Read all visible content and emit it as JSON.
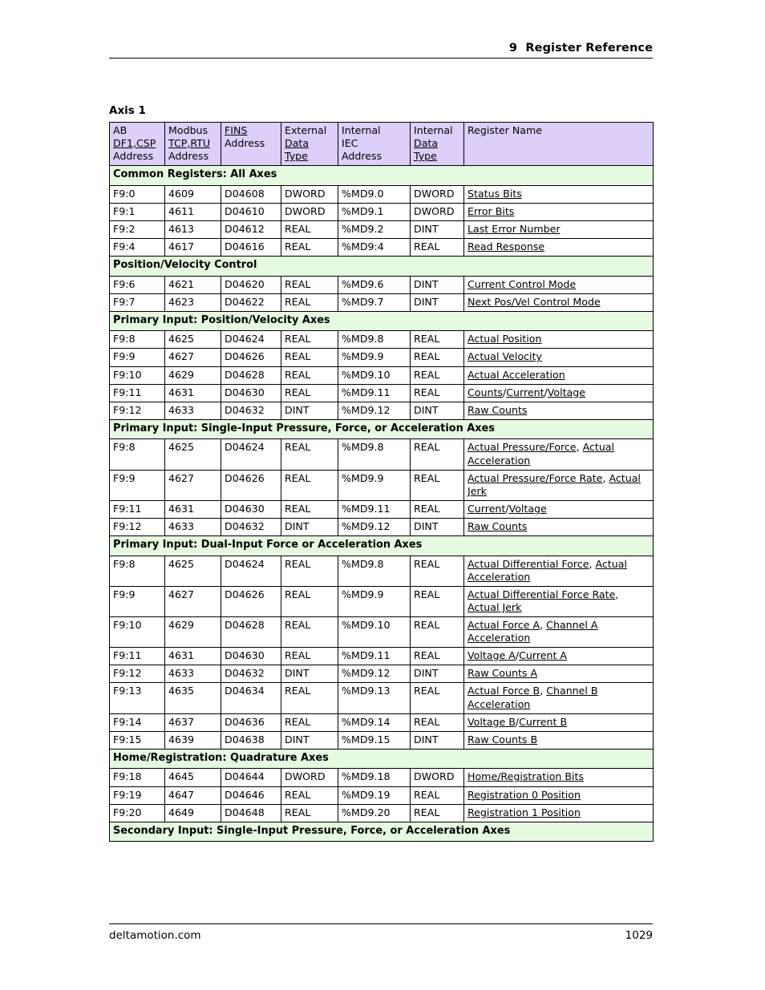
{
  "header": {
    "chapter_number": "9",
    "chapter_title": "Register Reference",
    "full_text": "9  Register Reference"
  },
  "footer": {
    "site": "deltamotion.com",
    "page_number": "1029"
  },
  "table": {
    "caption": "Axis 1",
    "columns": [
      {
        "key": "ab",
        "lines": [
          "AB",
          "DF1,CSP",
          "Address"
        ],
        "link_line_index": 1
      },
      {
        "key": "modbus",
        "lines": [
          "Modbus",
          "TCP,RTU",
          "Address"
        ],
        "link_line_index": 1
      },
      {
        "key": "fins",
        "lines": [
          "FINS",
          "Address"
        ],
        "link_line_index": 0
      },
      {
        "key": "extdtype",
        "lines": [
          "External",
          "Data",
          "Type"
        ],
        "link_line_index": 1,
        "link_line_index2": 2
      },
      {
        "key": "iecaddr",
        "lines": [
          "Internal",
          "IEC",
          "Address"
        ],
        "link_line_index": -1
      },
      {
        "key": "intdtype",
        "lines": [
          "Internal",
          "Data",
          "Type"
        ],
        "link_line_index": 1,
        "link_line_index2": 2
      },
      {
        "key": "regname",
        "lines": [
          "Register Name"
        ],
        "link_line_index": -1
      }
    ],
    "rows": [
      {
        "type": "section",
        "label": "Common Registers: All Axes"
      },
      {
        "type": "data",
        "ab": "F9:0",
        "modbus": "4609",
        "fins": "D04608",
        "ext": "DWORD",
        "iec": "%MD9.0",
        "int": "DWORD",
        "name": [
          {
            "t": "Status Bits",
            "link": true
          }
        ]
      },
      {
        "type": "data",
        "ab": "F9:1",
        "modbus": "4611",
        "fins": "D04610",
        "ext": "DWORD",
        "iec": "%MD9.1",
        "int": "DWORD",
        "name": [
          {
            "t": "Error Bits",
            "link": true
          }
        ]
      },
      {
        "type": "data",
        "ab": "F9:2",
        "modbus": "4613",
        "fins": "D04612",
        "ext": "REAL",
        "iec": "%MD9.2",
        "int": "DINT",
        "name": [
          {
            "t": "Last Error Number",
            "link": true
          }
        ]
      },
      {
        "type": "data",
        "ab": "F9:4",
        "modbus": "4617",
        "fins": "D04616",
        "ext": "REAL",
        "iec": "%MD9:4",
        "int": "REAL",
        "name": [
          {
            "t": "Read Response",
            "link": true
          }
        ]
      },
      {
        "type": "section",
        "label": "Position/Velocity Control"
      },
      {
        "type": "data",
        "ab": "F9:6",
        "modbus": "4621",
        "fins": "D04620",
        "ext": "REAL",
        "iec": "%MD9.6",
        "int": "DINT",
        "name": [
          {
            "t": "Current Control Mode",
            "link": true
          }
        ]
      },
      {
        "type": "data",
        "ab": "F9:7",
        "modbus": "4623",
        "fins": "D04622",
        "ext": "REAL",
        "iec": "%MD9.7",
        "int": "DINT",
        "name": [
          {
            "t": "Next Pos/Vel Control Mode",
            "link": true
          }
        ]
      },
      {
        "type": "section",
        "label": "Primary Input: Position/Velocity Axes"
      },
      {
        "type": "data",
        "ab": "F9:8",
        "modbus": "4625",
        "fins": "D04624",
        "ext": "REAL",
        "iec": "%MD9.8",
        "int": "REAL",
        "name": [
          {
            "t": "Actual Position",
            "link": true
          }
        ]
      },
      {
        "type": "data",
        "ab": "F9:9",
        "modbus": "4627",
        "fins": "D04626",
        "ext": "REAL",
        "iec": "%MD9.9",
        "int": "REAL",
        "name": [
          {
            "t": "Actual Velocity",
            "link": true
          }
        ]
      },
      {
        "type": "data",
        "ab": "F9:10",
        "modbus": "4629",
        "fins": "D04628",
        "ext": "REAL",
        "iec": "%MD9.10",
        "int": "REAL",
        "name": [
          {
            "t": "Actual Acceleration",
            "link": true
          }
        ]
      },
      {
        "type": "data",
        "ab": "F9:11",
        "modbus": "4631",
        "fins": "D04630",
        "ext": "REAL",
        "iec": "%MD9.11",
        "int": "REAL",
        "name": [
          {
            "t": "Counts",
            "link": true
          },
          {
            "t": "/",
            "link": false
          },
          {
            "t": "Current",
            "link": true
          },
          {
            "t": "/",
            "link": false
          },
          {
            "t": "Voltage",
            "link": true
          }
        ]
      },
      {
        "type": "data",
        "ab": "F9:12",
        "modbus": "4633",
        "fins": "D04632",
        "ext": "DINT",
        "iec": "%MD9.12",
        "int": "DINT",
        "name": [
          {
            "t": "Raw Counts",
            "link": true
          }
        ]
      },
      {
        "type": "section",
        "label": "Primary Input: Single-Input Pressure, Force, or Acceleration Axes"
      },
      {
        "type": "data",
        "ab": "F9:8",
        "modbus": "4625",
        "fins": "D04624",
        "ext": "REAL",
        "iec": "%MD9.8",
        "int": "REAL",
        "tall": true,
        "name": [
          {
            "t": "Actual Pressure/Force",
            "link": true
          },
          {
            "t": ", ",
            "link": false
          },
          {
            "t": "Actual Acceleration",
            "link": true
          }
        ]
      },
      {
        "type": "data",
        "ab": "F9:9",
        "modbus": "4627",
        "fins": "D04626",
        "ext": "REAL",
        "iec": "%MD9.9",
        "int": "REAL",
        "tall": true,
        "offset_first": true,
        "name": [
          {
            "t": "Actual Pressure/Force Rate",
            "link": true
          },
          {
            "t": ", ",
            "link": false
          },
          {
            "t": "Actual Jerk",
            "link": true
          }
        ]
      },
      {
        "type": "data",
        "ab": "F9:11",
        "modbus": "4631",
        "fins": "D04630",
        "ext": "REAL",
        "iec": "%MD9.11",
        "int": "REAL",
        "name": [
          {
            "t": "Current",
            "link": true
          },
          {
            "t": "/",
            "link": false
          },
          {
            "t": "Voltage",
            "link": true
          }
        ]
      },
      {
        "type": "data",
        "ab": "F9:12",
        "modbus": "4633",
        "fins": "D04632",
        "ext": "DINT",
        "iec": "%MD9.12",
        "int": "DINT",
        "name": [
          {
            "t": "Raw Counts",
            "link": true
          }
        ]
      },
      {
        "type": "section",
        "label": "Primary Input: Dual-Input Force or Acceleration Axes"
      },
      {
        "type": "data",
        "ab": "F9:8",
        "modbus": "4625",
        "fins": "D04624",
        "ext": "REAL",
        "iec": "%MD9.8",
        "int": "REAL",
        "tall": true,
        "name": [
          {
            "t": "Actual Differential Force",
            "link": true
          },
          {
            "t": ", ",
            "link": false
          },
          {
            "t": "Actual Acceleration",
            "link": true
          }
        ]
      },
      {
        "type": "data",
        "ab": "F9:9",
        "modbus": "4627",
        "fins": "D04626",
        "ext": "REAL",
        "iec": "%MD9.9",
        "int": "REAL",
        "tall": true,
        "offset_first": true,
        "name": [
          {
            "t": "Actual Differential Force Rate",
            "link": true
          },
          {
            "t": ", ",
            "link": false
          },
          {
            "t": "Actual Jerk",
            "link": true
          }
        ]
      },
      {
        "type": "data",
        "ab": "F9:10",
        "modbus": "4629",
        "fins": "D04628",
        "ext": "REAL",
        "iec": "%MD9.10",
        "int": "REAL",
        "tall": true,
        "offset_first": true,
        "name": [
          {
            "t": "Actual Force A",
            "link": true
          },
          {
            "t": ", ",
            "link": false
          },
          {
            "t": "Channel A Acceleration",
            "link": true
          }
        ]
      },
      {
        "type": "data",
        "ab": "F9:11",
        "modbus": "4631",
        "fins": "D04630",
        "ext": "REAL",
        "iec": "%MD9.11",
        "int": "REAL",
        "name": [
          {
            "t": "Voltage A",
            "link": true
          },
          {
            "t": "/",
            "link": false
          },
          {
            "t": "Current A",
            "link": true
          }
        ]
      },
      {
        "type": "data",
        "ab": "F9:12",
        "modbus": "4633",
        "fins": "D04632",
        "ext": "DINT",
        "iec": "%MD9.12",
        "int": "DINT",
        "name": [
          {
            "t": "Raw Counts A",
            "link": true
          }
        ]
      },
      {
        "type": "data",
        "ab": "F9:13",
        "modbus": "4635",
        "fins": "D04634",
        "ext": "REAL",
        "iec": "%MD9.13",
        "int": "REAL",
        "tall": true,
        "name": [
          {
            "t": "Actual Force B",
            "link": true
          },
          {
            "t": ", ",
            "link": false
          },
          {
            "t": "Channel B Acceleration",
            "link": true
          }
        ]
      },
      {
        "type": "data",
        "ab": "F9:14",
        "modbus": "4637",
        "fins": "D04636",
        "ext": "REAL",
        "iec": "%MD9.14",
        "int": "REAL",
        "name": [
          {
            "t": "Voltage B",
            "link": true
          },
          {
            "t": "/",
            "link": false
          },
          {
            "t": "Current B",
            "link": true
          }
        ]
      },
      {
        "type": "data",
        "ab": "F9:15",
        "modbus": "4639",
        "fins": "D04638",
        "ext": "DINT",
        "iec": "%MD9.15",
        "int": "DINT",
        "name": [
          {
            "t": "Raw Counts B",
            "link": true
          }
        ]
      },
      {
        "type": "section",
        "label": "Home/Registration: Quadrature Axes"
      },
      {
        "type": "data",
        "ab": "F9:18",
        "modbus": "4645",
        "fins": "D04644",
        "ext": "DWORD",
        "iec": "%MD9.18",
        "int": "DWORD",
        "name": [
          {
            "t": "Home/Registration Bits",
            "link": true
          }
        ]
      },
      {
        "type": "data",
        "ab": "F9:19",
        "modbus": "4647",
        "fins": "D04646",
        "ext": "REAL",
        "iec": "%MD9.19",
        "int": "REAL",
        "name": [
          {
            "t": "Registration 0 Position",
            "link": true
          }
        ]
      },
      {
        "type": "data",
        "ab": "F9:20",
        "modbus": "4649",
        "fins": "D04648",
        "ext": "REAL",
        "iec": "%MD9.20",
        "int": "REAL",
        "name": [
          {
            "t": "Registration 1 Position",
            "link": true
          }
        ]
      },
      {
        "type": "section",
        "label": "Secondary Input: Single-Input Pressure, Force, or Acceleration Axes"
      }
    ]
  },
  "colors": {
    "header_fill": "#ddcffa",
    "section_fill": "#e6fae1",
    "border": "#000000",
    "text": "#000000"
  }
}
